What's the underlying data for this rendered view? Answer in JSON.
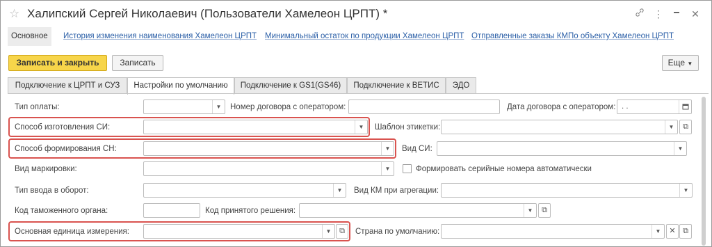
{
  "window": {
    "title": "Халипский Сергей Николаевич (Пользователи Хамелеон ЦРПТ) *",
    "controls": [
      "link-icon",
      "more-icon",
      "minimize-icon",
      "close-icon"
    ]
  },
  "nav": {
    "items": [
      {
        "label": "Основное",
        "active": true
      },
      {
        "label": "История изменения наименования Хамелеон ЦРПТ",
        "active": false
      },
      {
        "label": "Минимальный остаток по продукции Хамелеон ЦРПТ",
        "active": false
      },
      {
        "label": "Отправленные заказы КМПо объекту Хамелеон ЦРПТ",
        "active": false
      }
    ]
  },
  "toolbar": {
    "save_close_label": "Записать и закрыть",
    "save_label": "Записать",
    "more_label": "Еще"
  },
  "tabs": [
    {
      "label": "Подключение к ЦРПТ и СУЗ",
      "active": false
    },
    {
      "label": "Настройки по умолчанию",
      "active": true
    },
    {
      "label": "Подключение к GS1(GS46)",
      "active": false
    },
    {
      "label": "Подключение к ВЕТИС",
      "active": false
    },
    {
      "label": "ЭДО",
      "active": false
    }
  ],
  "form": {
    "payment_type_label": "Тип оплаты:",
    "payment_type_value": "",
    "contract_number_label": "Номер договора с оператором:",
    "contract_number_value": "",
    "contract_date_label": "Дата договора с оператором:",
    "contract_date_value": "  .  .",
    "production_method_label": "Способ изготовления СИ:",
    "production_method_value": "",
    "label_template_label": "Шаблон этикетки:",
    "label_template_value": "",
    "sn_method_label": "Способ формирования СН:",
    "sn_method_value": "",
    "si_type_label": "Вид СИ:",
    "si_type_value": "",
    "marking_type_label": "Вид маркировки:",
    "marking_type_value": "",
    "auto_serial_label": "Формировать серийные номера автоматически",
    "auto_serial_checked": false,
    "circulation_type_label": "Тип ввода в оборот:",
    "circulation_type_value": "",
    "km_type_label": "Вид КМ при агрегации:",
    "km_type_value": "",
    "customs_code_label": "Код таможенного органа:",
    "customs_code_value": "",
    "decision_code_label": "Код принятого решения:",
    "decision_code_value": "",
    "main_unit_label": "Основная единица измерения:",
    "main_unit_value": "",
    "default_country_label": "Страна по умолчанию:",
    "default_country_value": ""
  },
  "colors": {
    "primary_button": "#f7d54a",
    "highlight": "#d9534f",
    "link": "#2b5fa7"
  }
}
